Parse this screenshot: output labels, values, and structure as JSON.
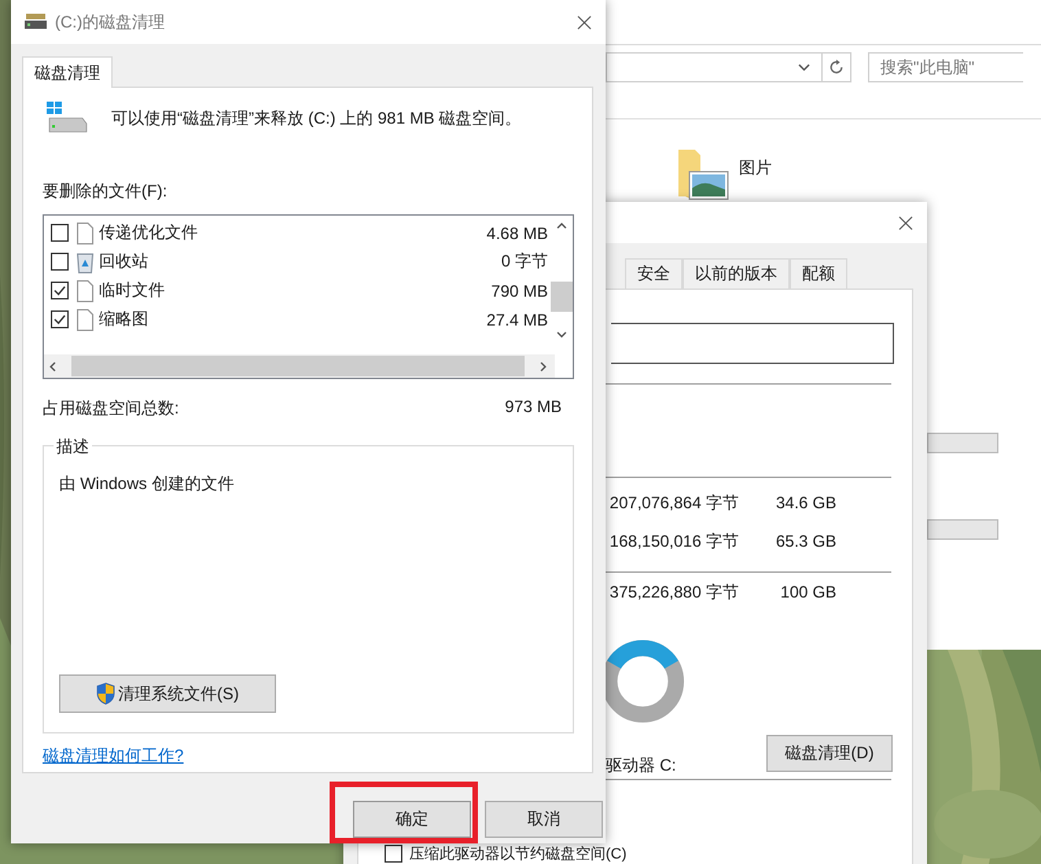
{
  "explorer": {
    "search": {
      "placeholder": "搜索\"此电脑\""
    },
    "items": [
      {
        "label": "图片"
      }
    ]
  },
  "properties_dialog": {
    "tabs": [
      {
        "label": "安全",
        "selected": false
      },
      {
        "label": "以前的版本",
        "selected": false
      },
      {
        "label": "配额",
        "selected": false
      }
    ],
    "space_rows": [
      {
        "bytes": "207,076,864 字节",
        "size": "34.6 GB"
      },
      {
        "bytes": "168,150,016 字节",
        "size": "65.3 GB"
      }
    ],
    "capacity": {
      "bytes": "375,226,880 字节",
      "size": "100 GB"
    },
    "drive_label": "驱动器 C:",
    "cleanup_button": "磁盘清理(D)",
    "compress_option": {
      "label": "压缩此驱动器以节约磁盘空间(C)",
      "checked": false
    }
  },
  "cleanup_dialog": {
    "title": "(C:)的磁盘清理",
    "tabs": [
      {
        "label": "磁盘清理",
        "selected": true
      }
    ],
    "intro": "可以使用“磁盘清理”来释放 (C:) 上的 981 MB 磁盘空间。",
    "files_label": "要删除的文件(F):",
    "files": [
      {
        "name": "传递优化文件",
        "size": "4.68 MB",
        "checked": false,
        "kind": "file"
      },
      {
        "name": "回收站",
        "size": "0 字节",
        "checked": false,
        "kind": "recycle"
      },
      {
        "name": "临时文件",
        "size": "790 MB",
        "checked": true,
        "kind": "file"
      },
      {
        "name": "缩略图",
        "size": "27.4 MB",
        "checked": true,
        "kind": "file"
      }
    ],
    "total_label": "占用磁盘空间总数:",
    "total": "973 MB",
    "description": {
      "title": "描述",
      "text": "由 Windows 创建的文件"
    },
    "system_button": "清理系统文件(S)",
    "help_link": "磁盘清理如何工作?",
    "buttons": [
      {
        "label": "确定",
        "highlighted": true
      },
      {
        "label": "取消",
        "highlighted": false
      }
    ]
  }
}
